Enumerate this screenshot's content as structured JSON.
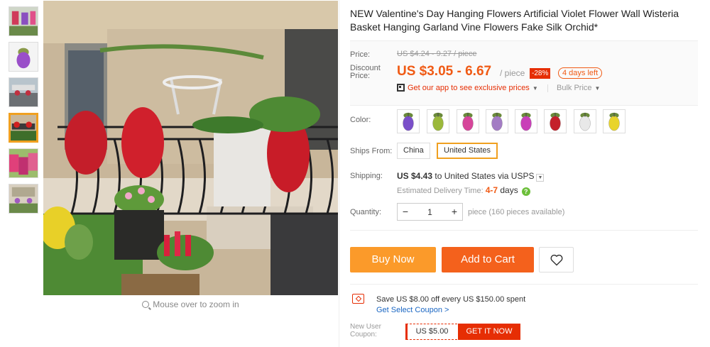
{
  "product": {
    "title": "NEW Valentine's Day Hanging Flowers Artificial Violet Flower Wall Wisteria Basket Hanging Garland Vine Flowers Fake Silk Orchid*"
  },
  "gallery": {
    "thumbnail_count": 6,
    "active_thumbnail": 4,
    "zoom_hint": "Mouse over to zoom in"
  },
  "price": {
    "price_label": "Price:",
    "original": "US $4.24 - 9.27 / piece",
    "discount_label_1": "Discount",
    "discount_label_2": "Price:",
    "current": "US $3.05 - 6.67",
    "per_piece": "/ piece",
    "discount_badge": "-28%",
    "days_left": "4 days left",
    "app_promo": "Get our app to see exclusive prices",
    "bulk_price": "Bulk Price"
  },
  "color": {
    "label": "Color:",
    "swatches": [
      "purple",
      "green-pink",
      "pink",
      "light-purple",
      "magenta",
      "red",
      "white",
      "yellow"
    ],
    "swatch_colors": [
      "#7a4fc9",
      "#9bb83a",
      "#d6459a",
      "#a37cc4",
      "#c93fb8",
      "#c4202a",
      "#e8e8e8",
      "#e8d42a"
    ]
  },
  "ships_from": {
    "label": "Ships From:",
    "options": [
      "China",
      "United States"
    ],
    "selected": "United States"
  },
  "shipping": {
    "label": "Shipping:",
    "cost": "US $4.43",
    "to_text": " to United States via USPS",
    "est_label": "Estimated Delivery Time: ",
    "est_days": "4-7",
    "days_word": " days"
  },
  "quantity": {
    "label": "Quantity:",
    "minus": "−",
    "value": "1",
    "plus": "+",
    "available": "piece (160 pieces available)"
  },
  "actions": {
    "buy_now": "Buy Now",
    "add_to_cart": "Add to Cart"
  },
  "coupon": {
    "text": "Save US $8.00 off every US $150.00 spent",
    "link": "Get Select Coupon >",
    "new_user_1": "New User",
    "new_user_2": "Coupon:",
    "amount": "US $5.00",
    "get_it": "GET IT NOW"
  },
  "colors": {
    "accent": "#f05a14",
    "buy_now": "#fb9a2a",
    "add_to_cart": "#f4611c",
    "badge_red": "#e62e04",
    "selected_border": "#f0a020",
    "link_blue": "#1a66c3"
  }
}
